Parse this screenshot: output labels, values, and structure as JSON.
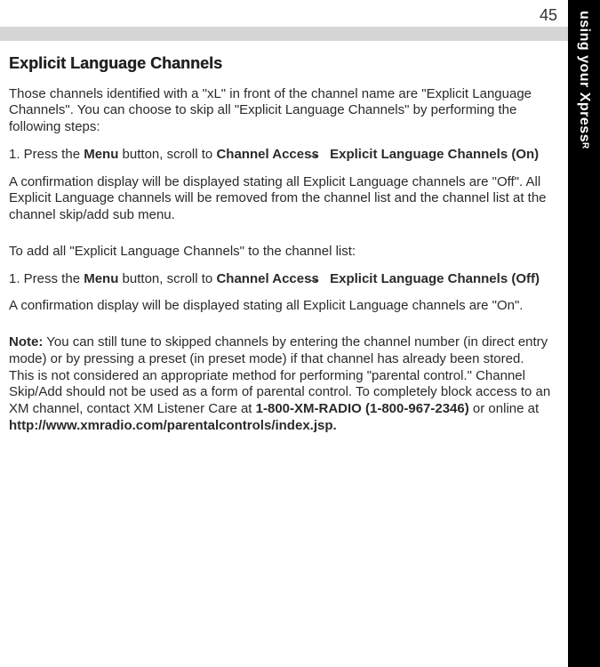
{
  "page_number": "45",
  "sidebar_label": "using your Xpress",
  "sidebar_sup": "R",
  "heading": "Explicit Language Channels",
  "intro": "Those channels identified with a \"xL\" in front of the channel name are \"Explicit Language Channels\". You can choose to skip all \"Explicit Language Channels\" by performing the following steps:",
  "step1_pre": "1. Press the ",
  "menu_bold": "Menu",
  "step1_mid": " button, scroll to ",
  "channel_access_bold": "Channel Access",
  "arrow": "→",
  "elc_on_bold": "Explicit Language Channels (On)",
  "confirm_off": "A confirmation display will be displayed stating all Explicit Language channels are \"Off\". All Explicit Language channels will be removed from the channel list and the channel list at the channel skip/add sub menu.",
  "add_intro": "To add all \"Explicit Language Channels\" to the channel list:",
  "elc_off_bold": "Explicit Language Channels (Off)",
  "confirm_on": "A confirmation display will be displayed stating all Explicit Language channels are \"On\".",
  "note_label": "Note:",
  "note_body1": " You can still tune to skipped channels by entering the channel number (in direct entry mode) or by pressing a preset (in preset mode) if that channel has already been stored. This is not considered an appropriate method for performing \"parental control.\" Channel Skip/Add should not be used as a form of parental control. To completely block access to an XM channel, contact XM Listener Care at ",
  "phone_bold": "1-800-XM-RADIO (1-800-967-2346)",
  "note_body2": " or online at ",
  "url_bold": "http://www.xmradio.com/parentalcontrols/index.jsp."
}
